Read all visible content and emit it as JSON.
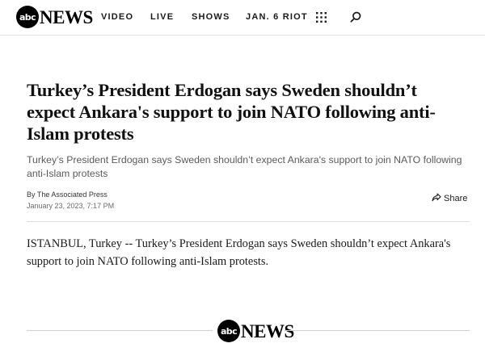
{
  "brand": {
    "logo_circle": "abc",
    "logo_word": "NEWS"
  },
  "nav": {
    "items": [
      {
        "label": "VIDEO"
      },
      {
        "label": "LIVE"
      },
      {
        "label": "SHOWS"
      },
      {
        "label": "JAN. 6 RIOT"
      }
    ],
    "icons": [
      "grid-icon",
      "search-icon"
    ]
  },
  "article": {
    "headline": "Turkey’s President Erdogan says Sweden shouldn’t expect Ankara's support to join NATO following anti-Islam protests",
    "subheadline": "Turkey’s President Erdogan says Sweden shouldn’t expect Ankara's support to join NATO following anti-Islam protests",
    "byline": "By The Associated Press",
    "date": "January 23, 2023, 7:17 PM",
    "share_label": "Share",
    "body": "ISTANBUL, Turkey -- Turkey’s President Erdogan says Sweden shouldn’t expect Ankara's support to join NATO following anti-Islam protests."
  },
  "footer": {
    "logo_circle": "abc",
    "logo_word": "NEWS"
  }
}
